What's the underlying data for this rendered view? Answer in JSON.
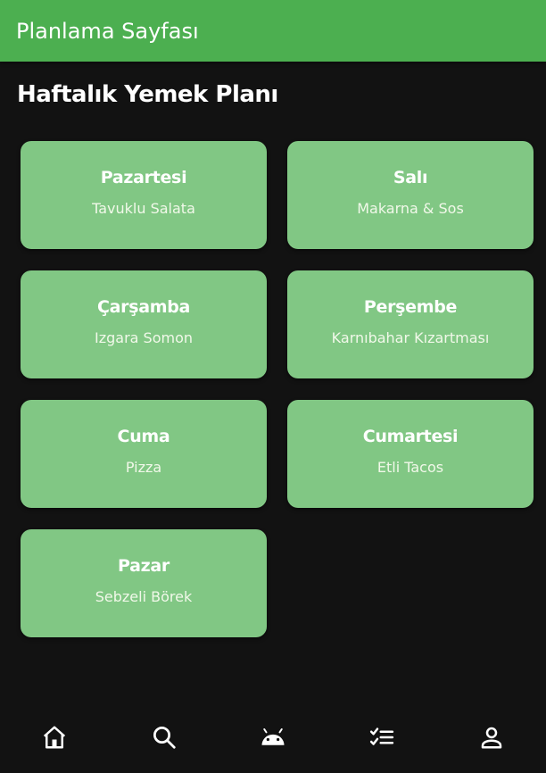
{
  "appbar": {
    "title": "Planlama Sayfası",
    "color": "#4CAF50"
  },
  "section": {
    "title": "Haftalık Yemek Planı"
  },
  "days": [
    {
      "day": "Pazartesi",
      "meal": "Tavuklu Salata"
    },
    {
      "day": "Salı",
      "meal": "Makarna & Sos"
    },
    {
      "day": "Çarşamba",
      "meal": "Izgara Somon"
    },
    {
      "day": "Perşembe",
      "meal": "Karnıbahar Kızartması"
    },
    {
      "day": "Cuma",
      "meal": "Pizza"
    },
    {
      "day": "Cumartesi",
      "meal": "Etli Tacos"
    },
    {
      "day": "Pazar",
      "meal": "Sebzeli Börek"
    }
  ],
  "card_color": "#81C784",
  "bottom_nav": [
    {
      "icon": "home-icon"
    },
    {
      "icon": "search-icon"
    },
    {
      "icon": "android-icon"
    },
    {
      "icon": "checklist-icon"
    },
    {
      "icon": "person-icon"
    }
  ]
}
